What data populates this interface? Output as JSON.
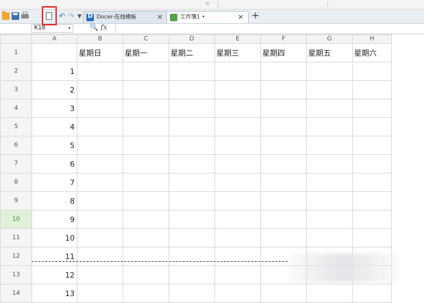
{
  "toolbar": {
    "top_mark": "≡",
    "undo_glyph": "↶",
    "redo_glyph": "↷",
    "dropdown_glyph": "▼"
  },
  "tabs": [
    {
      "label": "Docer-在线模板",
      "close": "×",
      "icon": "docer-icon"
    },
    {
      "label": "工作簿1 •",
      "close": "×",
      "icon": "workbook-icon"
    }
  ],
  "new_tab": "+",
  "formula_bar": {
    "name_box_value": "K10",
    "name_dropdown": "▾",
    "zoom_glyph": "🔍",
    "fx_label": "fx",
    "formula_value": ""
  },
  "columns": [
    "A",
    "B",
    "C",
    "D",
    "E",
    "F",
    "G",
    "H"
  ],
  "rows": [
    {
      "num": "1",
      "cells": [
        "",
        "星期日",
        "星期一",
        "星期二",
        "星期三",
        "星期四",
        "星期五",
        "星期六"
      ]
    },
    {
      "num": "2",
      "cells": [
        "1",
        "",
        "",
        "",
        "",
        "",
        "",
        ""
      ]
    },
    {
      "num": "3",
      "cells": [
        "2",
        "",
        "",
        "",
        "",
        "",
        "",
        ""
      ]
    },
    {
      "num": "4",
      "cells": [
        "3",
        "",
        "",
        "",
        "",
        "",
        "",
        ""
      ]
    },
    {
      "num": "5",
      "cells": [
        "4",
        "",
        "",
        "",
        "",
        "",
        "",
        ""
      ]
    },
    {
      "num": "6",
      "cells": [
        "5",
        "",
        "",
        "",
        "",
        "",
        "",
        ""
      ]
    },
    {
      "num": "7",
      "cells": [
        "6",
        "",
        "",
        "",
        "",
        "",
        "",
        ""
      ]
    },
    {
      "num": "8",
      "cells": [
        "7",
        "",
        "",
        "",
        "",
        "",
        "",
        ""
      ]
    },
    {
      "num": "9",
      "cells": [
        "8",
        "",
        "",
        "",
        "",
        "",
        "",
        ""
      ]
    },
    {
      "num": "10",
      "cells": [
        "9",
        "",
        "",
        "",
        "",
        "",
        "",
        ""
      ]
    },
    {
      "num": "11",
      "cells": [
        "10",
        "",
        "",
        "",
        "",
        "",
        "",
        ""
      ]
    },
    {
      "num": "12",
      "cells": [
        "11",
        "",
        "",
        "",
        "",
        "",
        "",
        ""
      ]
    },
    {
      "num": "13",
      "cells": [
        "12",
        "",
        "",
        "",
        "",
        "",
        "",
        ""
      ]
    },
    {
      "num": "14",
      "cells": [
        "13",
        "",
        "",
        "",
        "",
        "",
        "",
        ""
      ]
    }
  ],
  "active_row": "10",
  "colors": {
    "highlight_box": "#e42a2a",
    "active_row_header": "#e2f0d9",
    "grid_line": "#d9d9d9"
  }
}
